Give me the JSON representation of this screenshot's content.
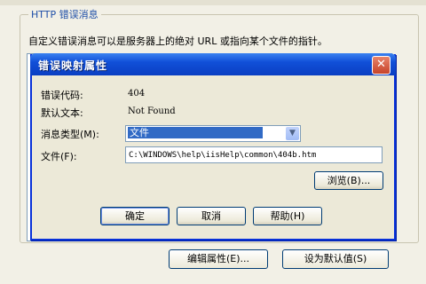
{
  "background": {
    "group_title": "HTTP 错误消息",
    "description": "自定义错误消息可以是服务器上的绝对 URL 或指向某个文件的指针。",
    "edit_properties_button": "编辑属性(E)...",
    "set_default_button": "设为默认值(S)"
  },
  "dialog": {
    "title": "错误映射属性",
    "close_symbol": "✕",
    "error_code_label": "错误代码:",
    "error_code_value": "404",
    "default_text_label": "默认文本:",
    "default_text_value": "Not Found",
    "message_type_label": "消息类型(M):",
    "message_type_value": "文件",
    "file_label": "文件(F):",
    "file_value": "C:\\WINDOWS\\help\\iisHelp\\common\\404b.htm",
    "browse_button": "浏览(B)...",
    "ok_button": "确定",
    "cancel_button": "取消",
    "help_button": "帮助(H)"
  }
}
